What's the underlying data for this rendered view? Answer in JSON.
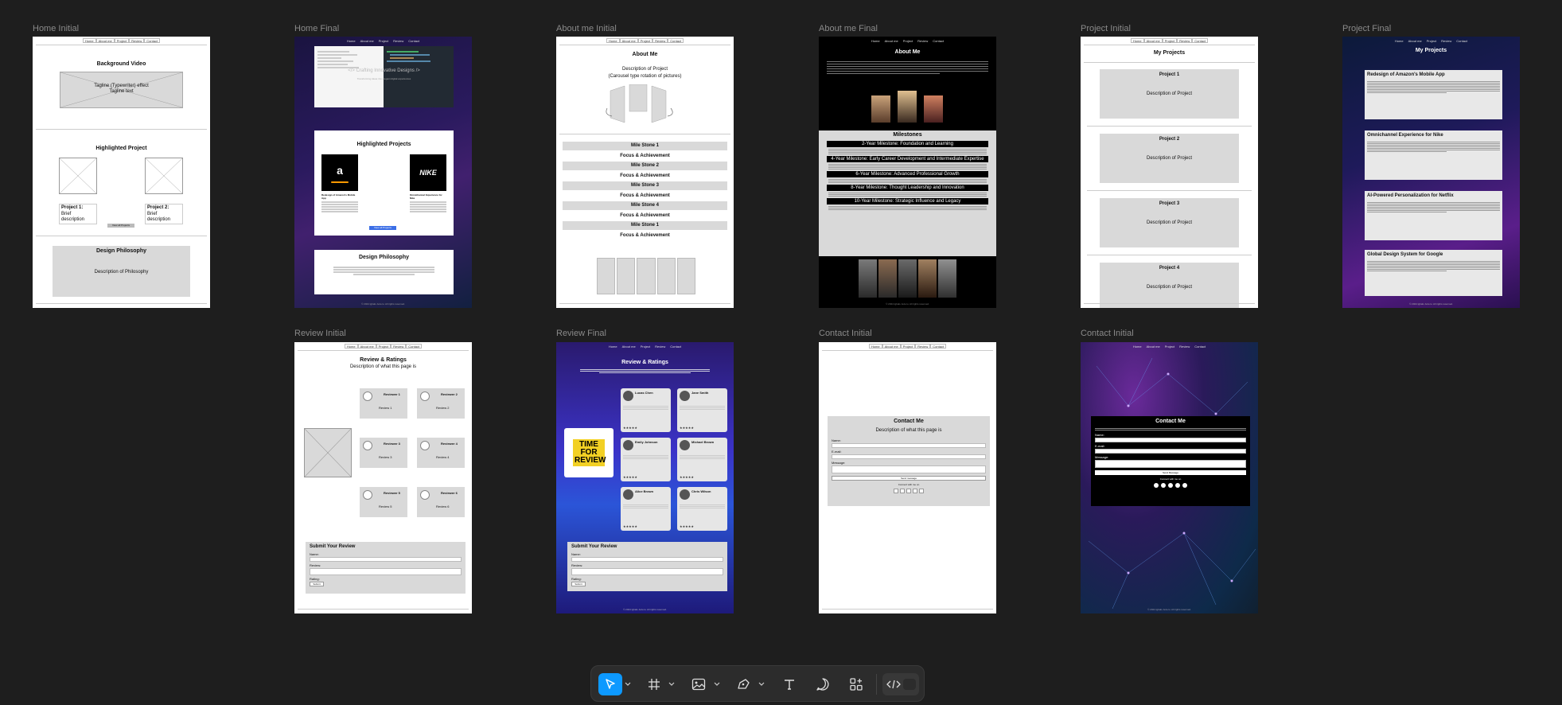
{
  "frames": {
    "home_initial": {
      "label": "Home Initial",
      "nav": [
        "Home",
        "About me",
        "Project",
        "Review",
        "Contact"
      ],
      "bg_video_title": "Background Video",
      "typewriter": "Tagline (Typewriter) effect\nTagline text",
      "highlighted_title": "Highlighted Project",
      "project1": "Project 1:",
      "project1_desc": "Brief description",
      "project2": "Project 2:",
      "project2_desc": "Brief description",
      "view_all": "View all Projects",
      "philosophy_title": "Design Philosophy",
      "philosophy_desc": "Description of Philosophy"
    },
    "home_final": {
      "label": "Home Final",
      "nav": [
        "Home",
        "About me",
        "Project",
        "Review",
        "Contact"
      ],
      "hero_text": "</> Crafting Innovative Designs />",
      "hero_sub": "Transforming ideas into elegant digital experiences",
      "highlighted_title": "Highlighted Projects",
      "amazon_title": "Redesign of Amazon's Mobile App",
      "nike_title": "Omnichannel Experience for Nike",
      "view_all": "View all Projects",
      "philosophy_title": "Design Philosophy",
      "footer": "© 2024 Igbals Jezeru. All rights reserved."
    },
    "about_initial": {
      "label": "About me Initial",
      "nav": [
        "Home",
        "About me",
        "Project",
        "Review",
        "Contact"
      ],
      "title": "About Me",
      "desc": "Description of Project",
      "carousel": "(Carousel type rotation of pictures)",
      "milestones": [
        {
          "bar": "Mile Stone 1",
          "focus": "Focus & Achievement"
        },
        {
          "bar": "Mile Stone 2",
          "focus": "Focus & Achievement"
        },
        {
          "bar": "Mile Stone 3",
          "focus": "Focus & Achievement"
        },
        {
          "bar": "Mile Stone 4",
          "focus": "Focus & Achievement"
        },
        {
          "bar": "Mile Stone 1",
          "focus": "Focus & Achievement"
        }
      ]
    },
    "about_final": {
      "label": "About me Final",
      "nav": [
        "Home",
        "About me",
        "Project",
        "Review",
        "Contact"
      ],
      "title": "About Me",
      "milestones_title": "Milestones",
      "milestones": [
        "2-Year Milestone: Foundation and Learning",
        "4-Year Milestone: Early Career Development and Intermediate Expertise",
        "6-Year Milestone: Advanced Professional Growth",
        "8-Year Milestone: Thought Leadership and Innovation",
        "10-Year Milestone: Strategic Influence and Legacy"
      ],
      "footer": "© 2024 Igbals Jezeru. All rights reserved."
    },
    "project_initial": {
      "label": "Project Initial",
      "nav": [
        "Home",
        "About me",
        "Project",
        "Review",
        "Contact"
      ],
      "title": "My Projects",
      "projects": [
        {
          "title": "Project 1",
          "desc": "Description of Project"
        },
        {
          "title": "Project 2",
          "desc": "Description of Project"
        },
        {
          "title": "Project 3",
          "desc": "Description of Project"
        },
        {
          "title": "Project 4",
          "desc": "Description of Project"
        }
      ]
    },
    "project_final": {
      "label": "Project Final",
      "nav": [
        "Home",
        "About me",
        "Project",
        "Review",
        "Contact"
      ],
      "title": "My Projects",
      "projects": [
        "Redesign of Amazon's Mobile App",
        "Omnichannel Experience for Nike",
        "AI-Powered Personalization for Netflix",
        "Global Design System for Google"
      ],
      "footer": "© 2024 Igbals Jezeru. All rights reserved."
    },
    "review_initial": {
      "label": "Review Initial",
      "nav": [
        "Home",
        "About me",
        "Project",
        "Review",
        "Contact"
      ],
      "title": "Review & Ratings",
      "desc": "Description of what this page is",
      "reviewers": [
        {
          "name": "Reviewer 1",
          "review": "Review 1"
        },
        {
          "name": "Reviewer 2",
          "review": "Review 2"
        },
        {
          "name": "Reviewer 3",
          "review": "Review 3"
        },
        {
          "name": "Reviewer 4",
          "review": "Review 4"
        },
        {
          "name": "Reviewer 5",
          "review": "Review 5"
        },
        {
          "name": "Reviewer 6",
          "review": "Review 6"
        }
      ],
      "form_title": "Submit Your Review",
      "form_name": "Name:",
      "form_review": "Review:",
      "form_rating": "Rating:",
      "form_submit": "Submit"
    },
    "review_final": {
      "label": "Review Final",
      "nav": [
        "Home",
        "About me",
        "Project",
        "Review",
        "Contact"
      ],
      "title": "Review & Ratings",
      "sticker": "TIME FOR REVIEW",
      "reviewers": [
        "Lucas Chen",
        "Jane Smith",
        "Emily Johnson",
        "Michael Brown",
        "Alice Brown",
        "Chris Wilson"
      ],
      "form_title": "Submit Your Review",
      "form_name": "Name:",
      "form_review": "Review:",
      "form_rating": "Rating:",
      "form_submit": "Submit",
      "footer": "© 2024 Igbals Jezeru. All rights reserved."
    },
    "contact_initial": {
      "label": "Contact Initial",
      "nav": [
        "Home",
        "About me",
        "Project",
        "Review",
        "Contact"
      ],
      "title": "Contact Me",
      "desc": "Description of what this page is",
      "name": "Name:",
      "email": "E-mail:",
      "message": "Message:",
      "send": "Send message",
      "connect": "Connect with me on"
    },
    "contact_initial_2": {
      "label": "Contact Initial",
      "nav": [
        "Home",
        "About me",
        "Project",
        "Review",
        "Contact"
      ],
      "title": "Contact Me",
      "name": "Name:",
      "email": "E-mail:",
      "message": "Message:",
      "send": "Send Message",
      "connect": "Connect with me on",
      "footer": "© 2024 Igbals Jezeru. All rights reserved."
    }
  },
  "toolbar": {
    "tools": [
      "move-icon",
      "frame-icon",
      "image-icon",
      "pen-icon",
      "text-icon",
      "comment-icon",
      "actions-icon",
      "dev-mode-icon"
    ],
    "accent": "#0d99ff"
  }
}
